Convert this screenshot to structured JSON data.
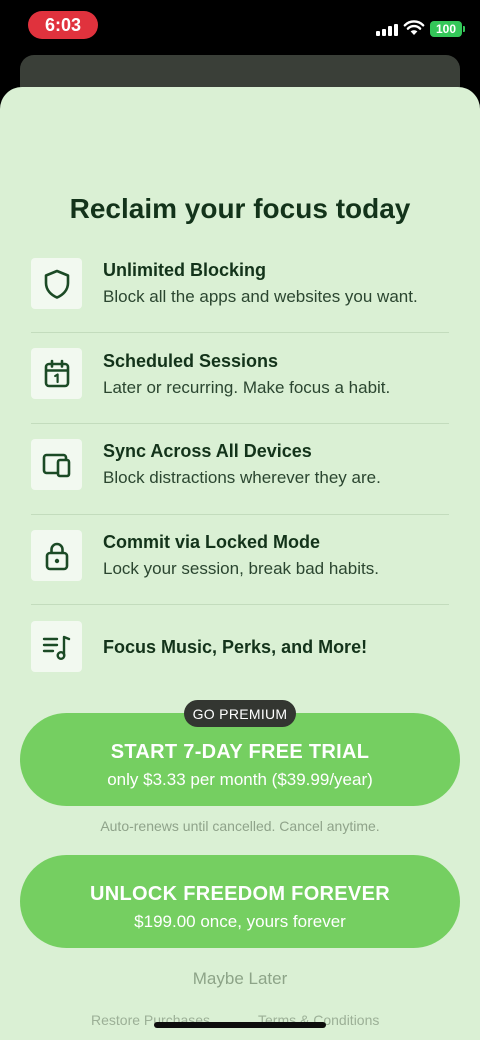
{
  "status_bar": {
    "time": "6:03",
    "battery": "100"
  },
  "title": "Reclaim your focus today",
  "features": [
    {
      "icon": "shield-icon",
      "title": "Unlimited Blocking",
      "desc": "Block all the apps and websites you want."
    },
    {
      "icon": "calendar-icon",
      "title": "Scheduled Sessions",
      "desc": "Later or recurring. Make focus a habit."
    },
    {
      "icon": "devices-icon",
      "title": "Sync Across All Devices",
      "desc": "Block distractions wherever they are."
    },
    {
      "icon": "lock-icon",
      "title": "Commit via Locked Mode",
      "desc": "Lock your session, break bad habits."
    },
    {
      "icon": "music-list-icon",
      "title": "Focus Music, Perks, and More!",
      "desc": ""
    }
  ],
  "premium_badge": "GO PREMIUM",
  "trial_button": {
    "label": "START 7-DAY FREE TRIAL",
    "sub": "only $3.33 per month ($39.99/year)"
  },
  "auto_renew_note": "Auto-renews until cancelled. Cancel anytime.",
  "forever_button": {
    "label": "UNLOCK FREEDOM FOREVER",
    "sub": "$199.00 once, yours forever"
  },
  "maybe_later": "Maybe Later",
  "footer": {
    "restore": "Restore Purchases",
    "terms": "Terms & Conditions"
  },
  "colors": {
    "sheet_bg": "#daf0d4",
    "accent_green": "#75cf61",
    "text_dark": "#13331a",
    "badge_bg": "#333631"
  }
}
